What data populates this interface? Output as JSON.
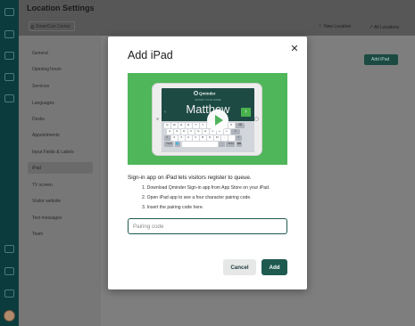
{
  "header": {
    "title": "Location Settings",
    "location_select": "SmartCon Center",
    "new_location": "New Location",
    "all_locations": "All Locations"
  },
  "sidebar": {
    "items": [
      {
        "label": "General"
      },
      {
        "label": "Opening hours"
      },
      {
        "label": "Services"
      },
      {
        "label": "Languages"
      },
      {
        "label": "Desks"
      },
      {
        "label": "Appointments"
      },
      {
        "label": "Input Fields & Labels"
      },
      {
        "label": "iPad",
        "active": true
      },
      {
        "label": "TV screen"
      },
      {
        "label": "Visitor website"
      },
      {
        "label": "Text messages"
      },
      {
        "label": "Team"
      }
    ]
  },
  "main": {
    "add_ipad_label": "Add iPad"
  },
  "modal": {
    "title": "Add iPad",
    "close_glyph": "✕",
    "hero": {
      "logo_text": "Qminder",
      "subtitle": "ENTER YOUR NAME",
      "typed_name": "Matthew",
      "next_glyph": "›",
      "prev_glyph": "‹",
      "keyboard_rows": [
        [
          "Q",
          "W",
          "E",
          "R",
          "T",
          "Y",
          "U",
          "I",
          "O",
          "P",
          "⌫"
        ],
        [
          "A",
          "S",
          "D",
          "F",
          "G",
          "H",
          "J",
          "K",
          "L",
          "↵"
        ],
        [
          "⇧",
          "Z",
          "X",
          "C",
          "V",
          "B",
          "N",
          "M",
          ",",
          ".",
          "⇧"
        ],
        [
          ".?123",
          "🌐",
          "",
          "",
          ".?123",
          "⌨"
        ]
      ]
    },
    "description": "Sign-in app on iPad lets visitors register to queue.",
    "steps": [
      "1. Download Qminder Sign-in app from App Store on your iPad.",
      "2. Open iPad app to see a four character pairing code.",
      "3. Insert the pairing code here."
    ],
    "pairing_input": {
      "value": "",
      "placeholder": "Pairing code"
    },
    "cancel_label": "Cancel",
    "add_label": "Add"
  },
  "colors": {
    "brand_dark": "#1e5a50",
    "hero_green": "#4fb65a",
    "overlay": "#7d7d7d"
  }
}
